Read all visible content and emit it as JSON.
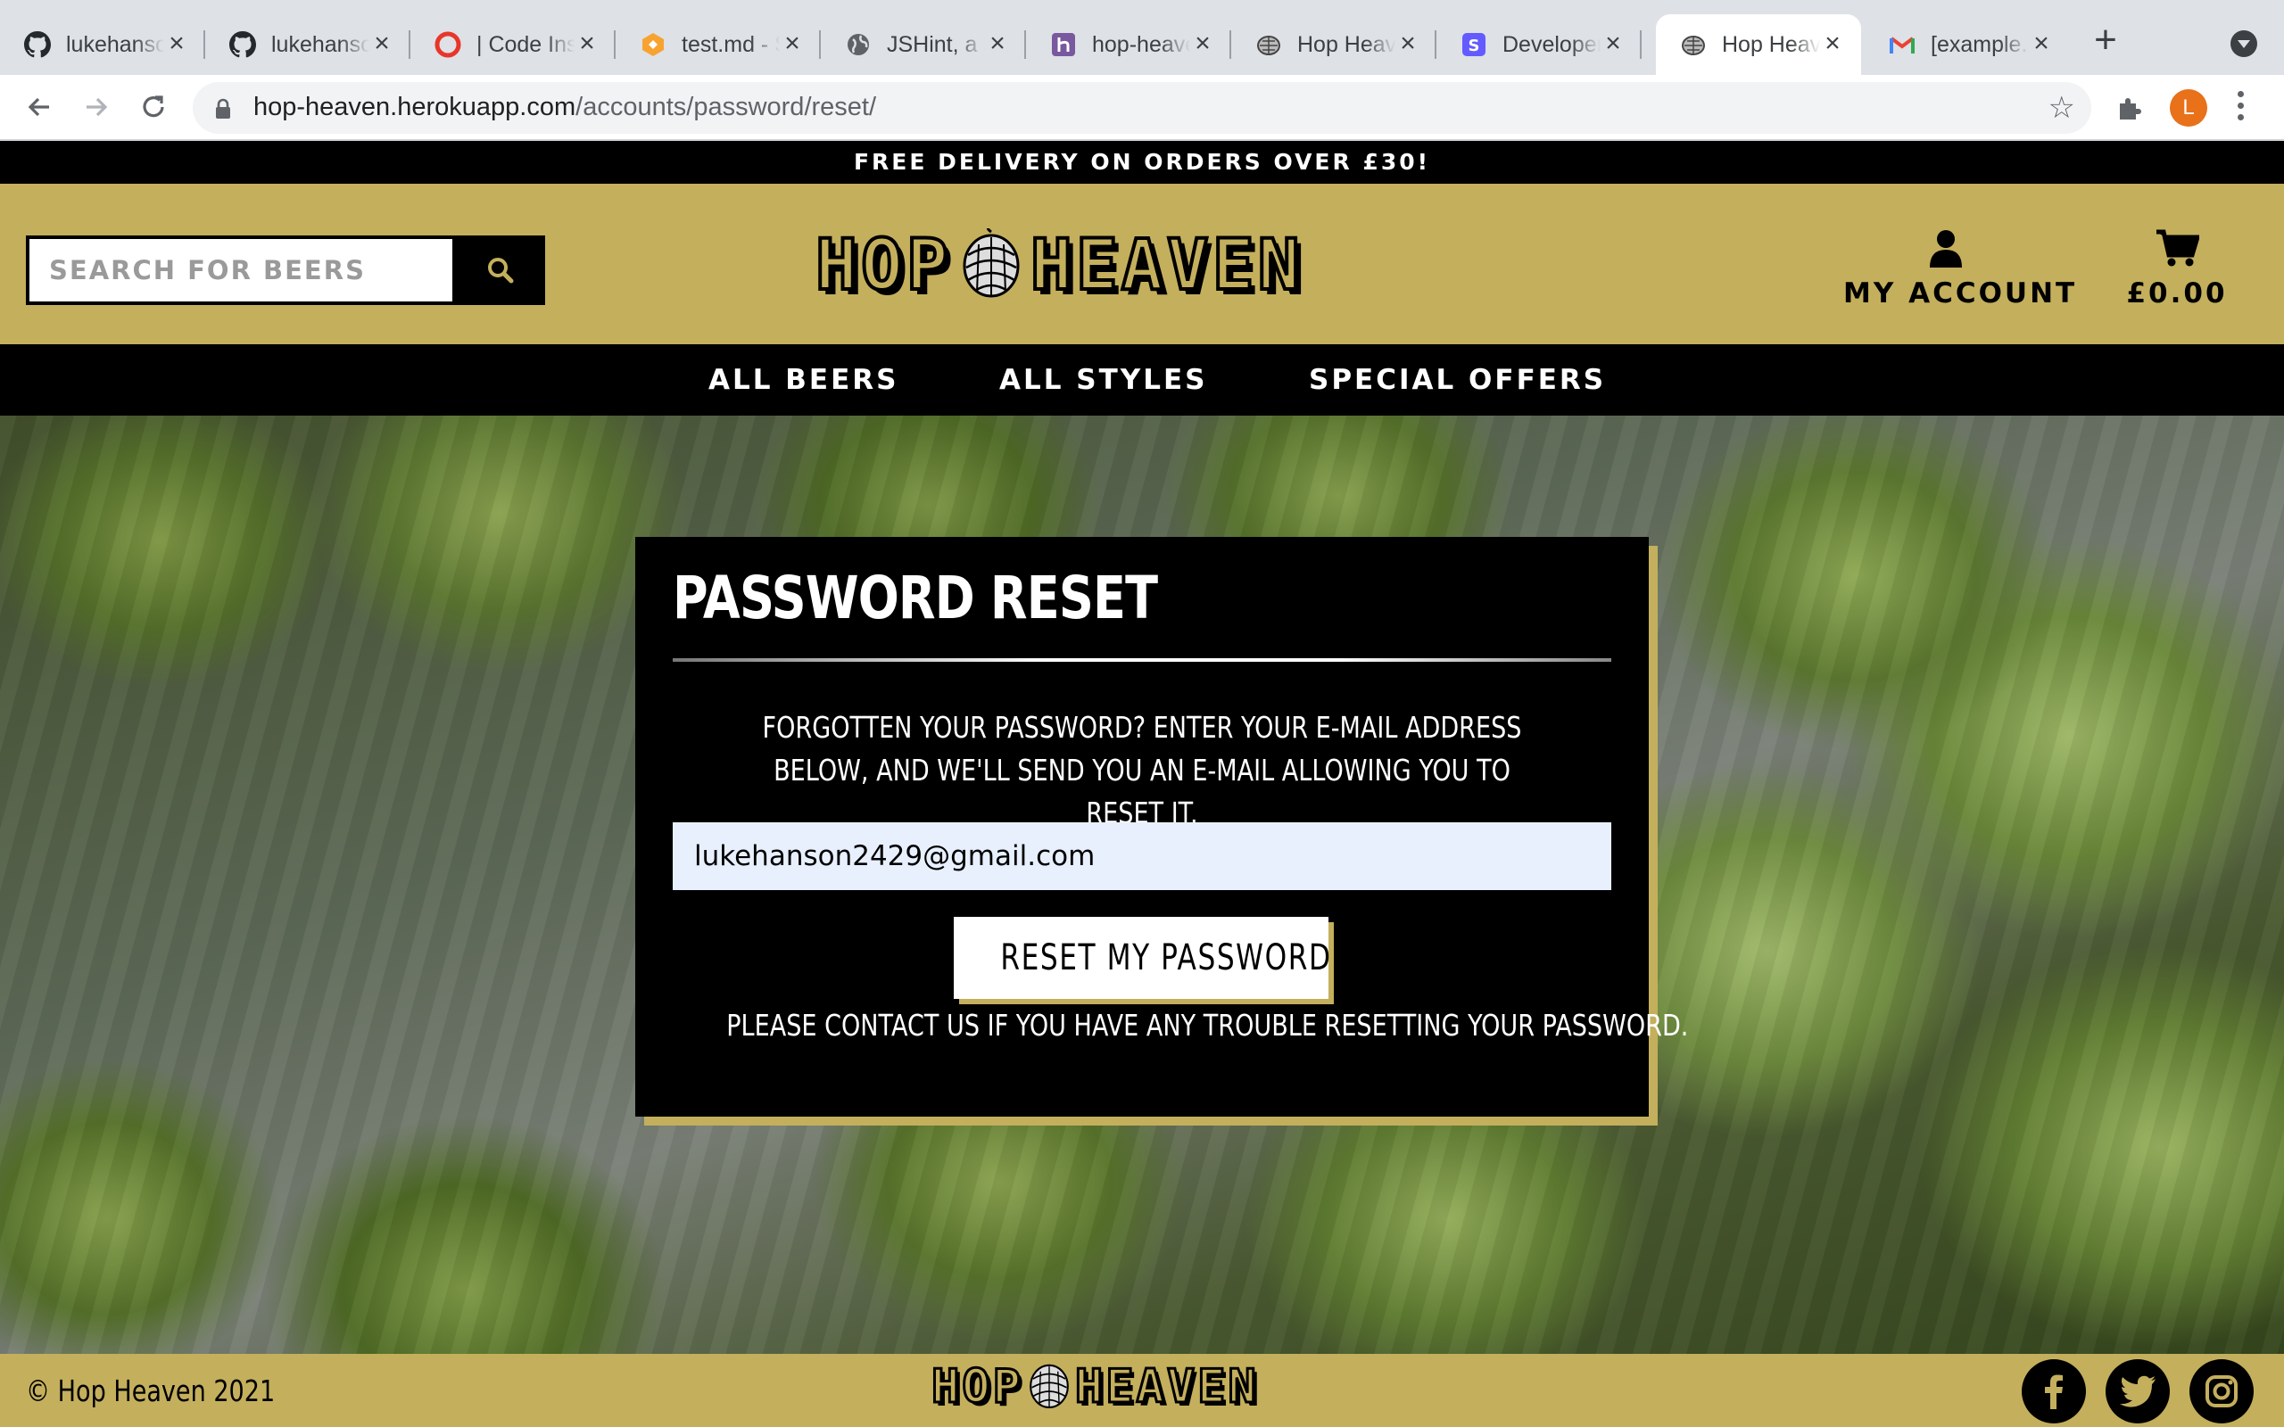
{
  "browser": {
    "tabs": [
      {
        "title": "lukehanson",
        "icon": "github-icon"
      },
      {
        "title": "lukehanson",
        "icon": "github-icon"
      },
      {
        "title": "| Code Institute",
        "icon": "opera-icon"
      },
      {
        "title": "test.md - StackEdit",
        "icon": "stackedit-icon"
      },
      {
        "title": "JSHint, a JavaScript",
        "icon": "globe-icon"
      },
      {
        "title": "hop-heaven",
        "icon": "heroku-icon"
      },
      {
        "title": "Hop Heaven",
        "icon": "hop-icon"
      },
      {
        "title": "Developers",
        "icon": "stripe-icon"
      },
      {
        "title": "Hop Heaven",
        "icon": "hop-icon"
      },
      {
        "title": "[example.com]",
        "icon": "gmail-icon"
      }
    ],
    "url_host": "hop-heaven.herokuapp.com",
    "url_path": "/accounts/password/reset/",
    "profile_initial": "L"
  },
  "site": {
    "banner": "FREE DELIVERY ON ORDERS OVER £30!",
    "search_placeholder": "SEARCH FOR BEERS",
    "logo_left": "HOP",
    "logo_right": "HEAVEN",
    "account_label": "MY ACCOUNT",
    "cart_total": "£0.00",
    "nav": [
      "ALL BEERS",
      "ALL STYLES",
      "SPECIAL OFFERS"
    ]
  },
  "form": {
    "title": "PASSWORD RESET",
    "description": "FORGOTTEN YOUR PASSWORD? ENTER YOUR E-MAIL ADDRESS BELOW, AND WE'LL SEND YOU AN E-MAIL ALLOWING YOU TO RESET IT.",
    "email_value": "lukehanson2429@gmail.com",
    "submit_label": "RESET MY PASSWORD",
    "help_text": "PLEASE CONTACT US IF YOU HAVE ANY TROUBLE RESETTING YOUR PASSWORD."
  },
  "footer": {
    "copyright": "© Hop Heaven 2021",
    "social": [
      "facebook-icon",
      "twitter-icon",
      "instagram-icon"
    ]
  },
  "colors": {
    "brand_gold": "#c4af5d",
    "black": "#000000",
    "input_fill": "#e8f0fe"
  }
}
